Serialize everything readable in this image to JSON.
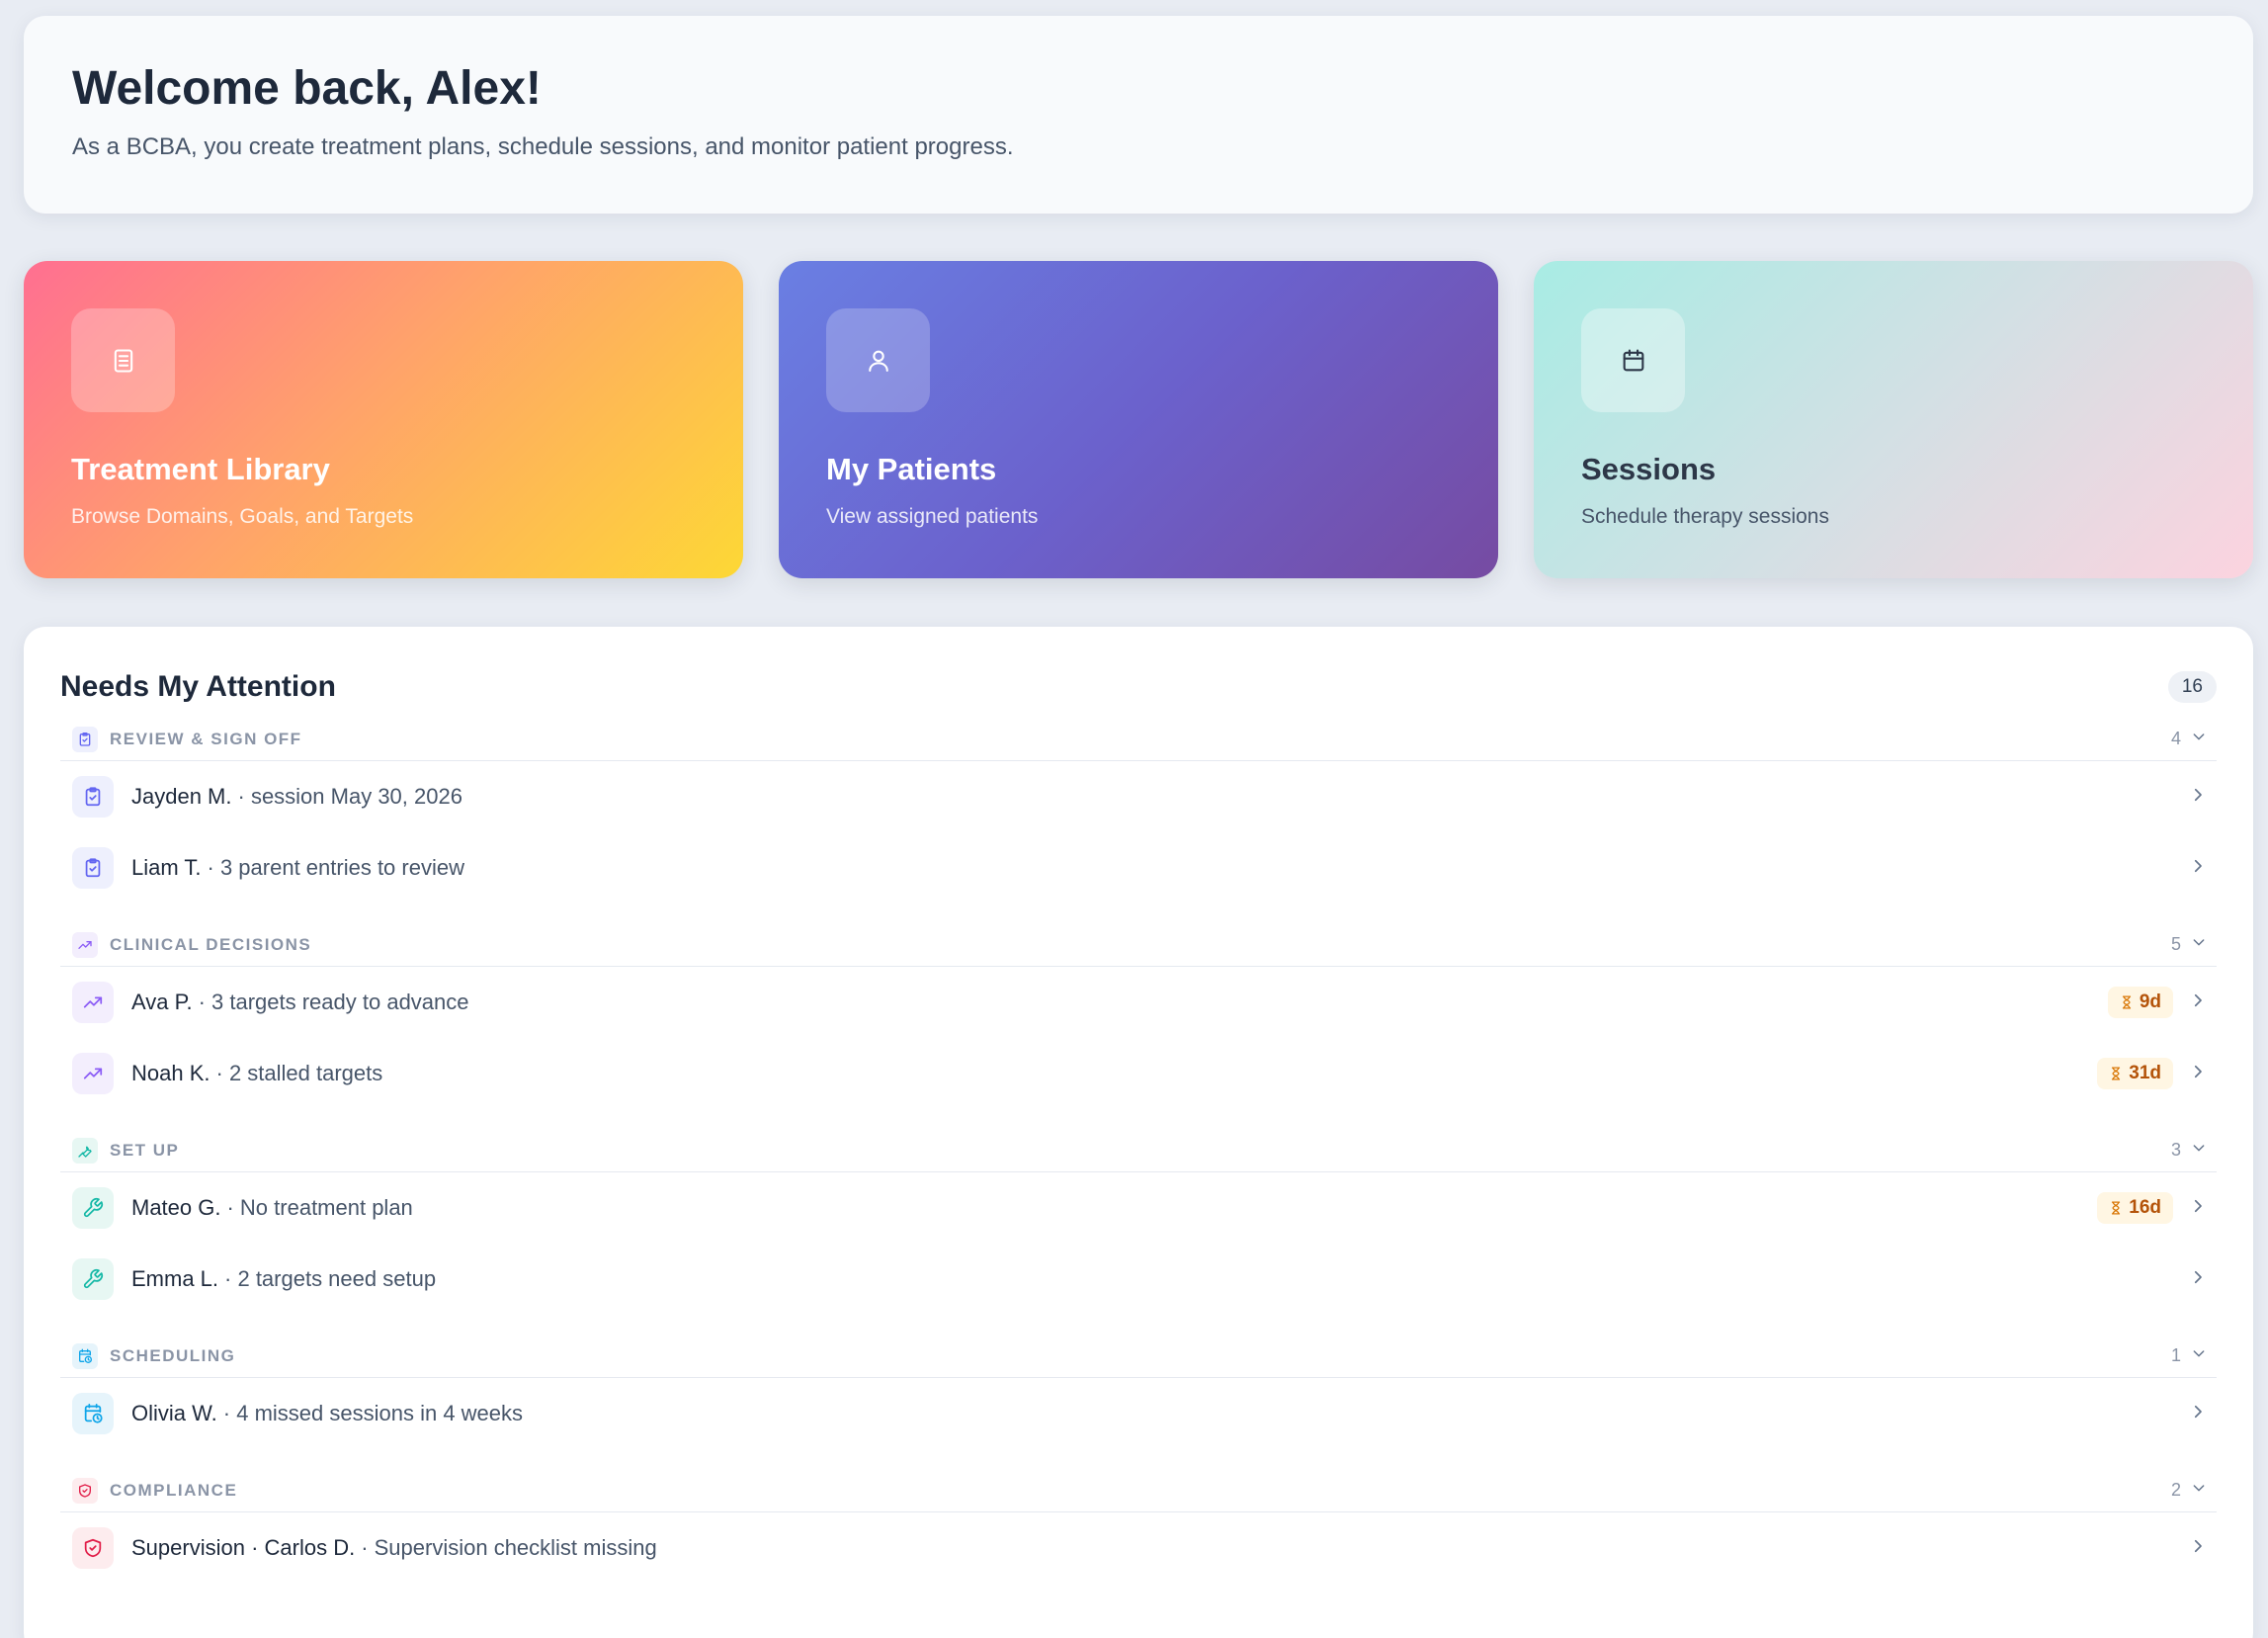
{
  "welcome": {
    "title": "Welcome back, Alex!",
    "subtitle": "As a BCBA, you create treatment plans, schedule sessions, and monitor patient progress."
  },
  "cards": [
    {
      "title": "Treatment Library",
      "subtitle": "Browse Domains, Goals, and Targets",
      "icon": "document-icon"
    },
    {
      "title": "My Patients",
      "subtitle": "View assigned patients",
      "icon": "user-icon"
    },
    {
      "title": "Sessions",
      "subtitle": "Schedule therapy sessions",
      "icon": "calendar-icon"
    }
  ],
  "attention": {
    "title": "Needs My Attention",
    "total": "16",
    "sections": [
      {
        "title": "REVIEW & SIGN OFF",
        "count": "4",
        "icon": "clipboard-check-icon",
        "color": "#6366f1",
        "rows": [
          {
            "name": "Jayden M.",
            "detail": "· session May 30, 2026"
          },
          {
            "name": "Liam T.",
            "detail": "· 3 parent entries to review"
          }
        ]
      },
      {
        "title": "CLINICAL DECISIONS",
        "count": "5",
        "icon": "trending-up-icon",
        "color": "#8b5cf6",
        "rows": [
          {
            "name": "Ava P.",
            "detail": "· 3 targets ready to advance",
            "badge": "9d"
          },
          {
            "name": "Noah K.",
            "detail": "· 2 stalled targets",
            "badge": "31d"
          }
        ]
      },
      {
        "title": "SET UP",
        "count": "3",
        "icon": "wrench-icon",
        "color": "#14b8a6",
        "rows": [
          {
            "name": "Mateo G.",
            "detail": "· No treatment plan",
            "badge": "16d"
          },
          {
            "name": "Emma L.",
            "detail": "· 2 targets need setup"
          }
        ]
      },
      {
        "title": "SCHEDULING",
        "count": "1",
        "icon": "calendar-clock-icon",
        "color": "#0ea5e9",
        "rows": [
          {
            "name": "Olivia W.",
            "detail": "· 4 missed sessions in 4 weeks"
          }
        ]
      },
      {
        "title": "COMPLIANCE",
        "count": "2",
        "icon": "shield-check-icon",
        "color": "#e11d48",
        "rows": [
          {
            "name": "Supervision · Carlos D.",
            "detail": "· Supervision checklist missing"
          }
        ]
      }
    ]
  }
}
